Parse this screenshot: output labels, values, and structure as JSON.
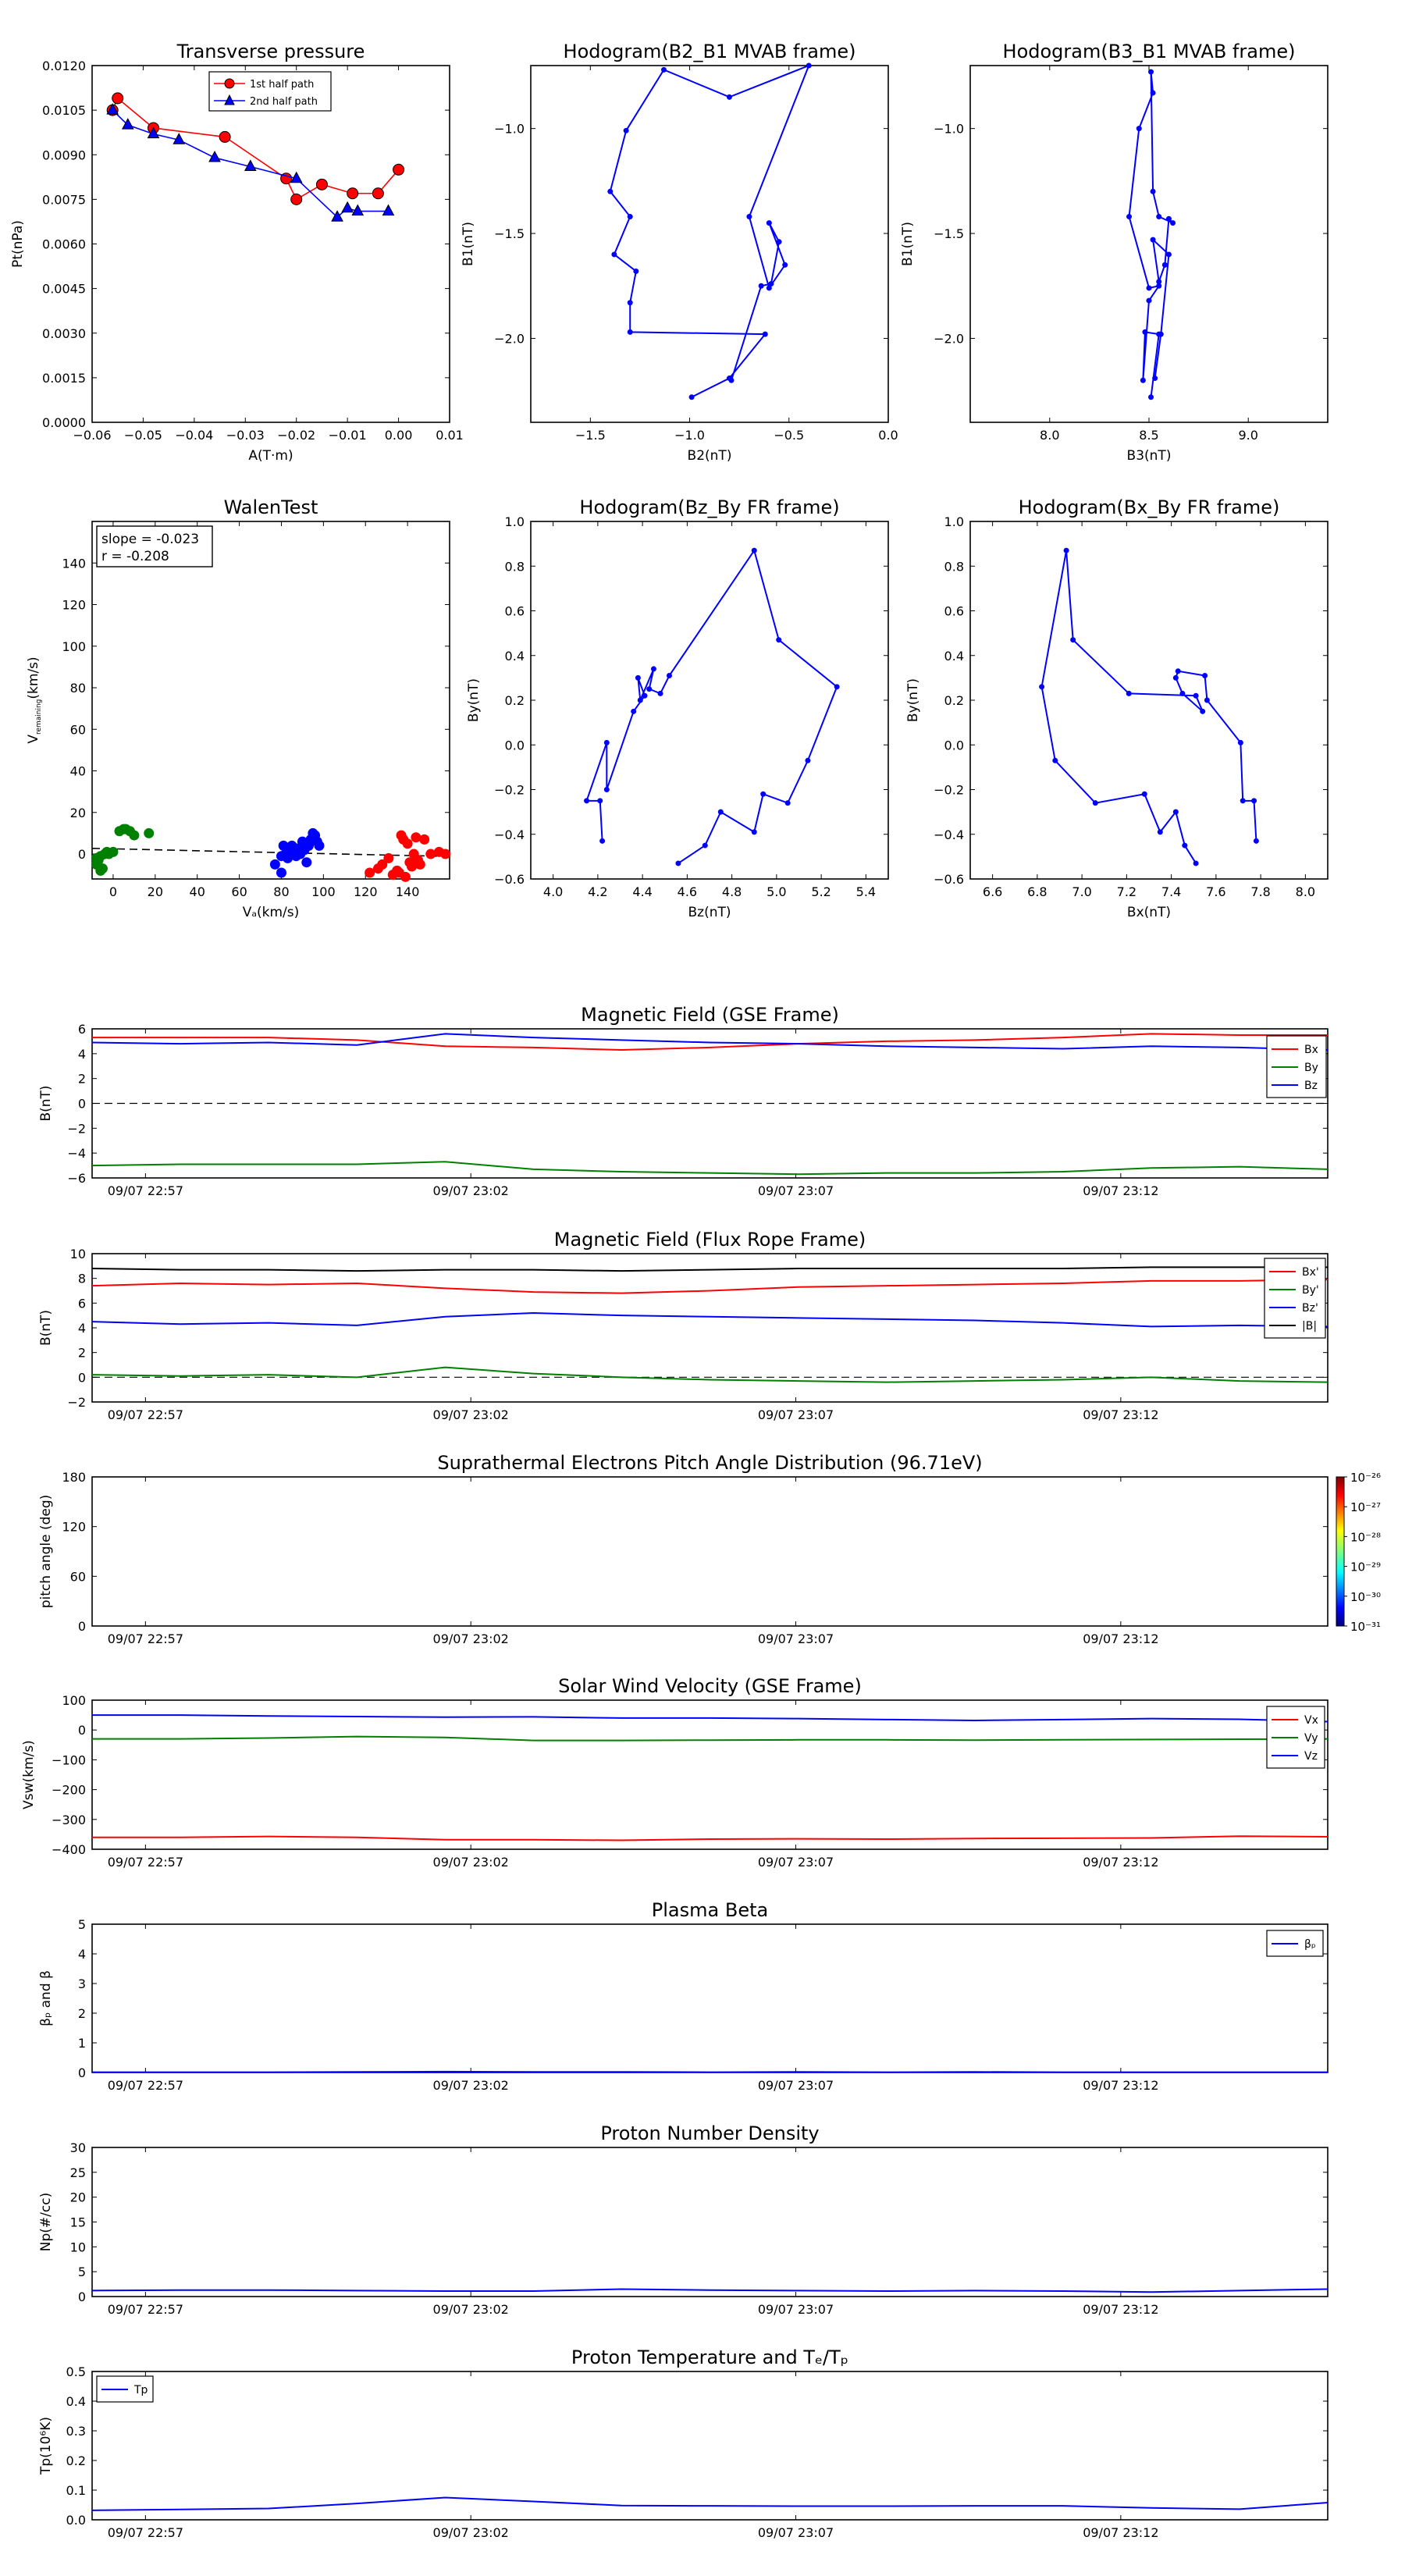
{
  "chart_data": [
    {
      "id": "pt",
      "type": "scatter",
      "title": "Transverse pressure",
      "xlabel": "A(T·m)",
      "ylabel": "Pt(nPa)",
      "xlim": [
        -0.06,
        0.01
      ],
      "ylim": [
        0.0,
        0.012
      ],
      "xticks": [
        -0.06,
        -0.05,
        -0.04,
        -0.03,
        -0.02,
        -0.01,
        0.0,
        0.01
      ],
      "xtick_labels": [
        "−0.06",
        "−0.05",
        "−0.04",
        "−0.03",
        "−0.02",
        "−0.01",
        "0.00",
        "0.01"
      ],
      "yticks": [
        0.0,
        0.0015,
        0.003,
        0.0045,
        0.006,
        0.0075,
        0.009,
        0.0105,
        0.012
      ],
      "ytick_labels": [
        "0.0000",
        "0.0015",
        "0.0030",
        "0.0045",
        "0.0060",
        "0.0075",
        "0.0090",
        "0.0105",
        "0.0120"
      ],
      "legend": "top-center",
      "series": [
        {
          "name": "1st half path",
          "color": "#ff0000",
          "marker": "circle",
          "x": [
            -0.056,
            -0.055,
            -0.048,
            -0.034,
            -0.022,
            -0.02,
            -0.015,
            -0.009,
            -0.004,
            0.0
          ],
          "y": [
            0.0105,
            0.0109,
            0.0099,
            0.0096,
            0.0082,
            0.0075,
            0.008,
            0.0077,
            0.0077,
            0.0085
          ]
        },
        {
          "name": "2nd half path",
          "color": "#0000ff",
          "marker": "triangle",
          "x": [
            -0.056,
            -0.053,
            -0.048,
            -0.043,
            -0.036,
            -0.029,
            -0.02,
            -0.012,
            -0.01,
            -0.008,
            -0.002
          ],
          "y": [
            0.0105,
            0.01,
            0.0097,
            0.0095,
            0.0089,
            0.0086,
            0.0082,
            0.0069,
            0.0072,
            0.0071,
            0.0071
          ]
        }
      ]
    },
    {
      "id": "hodo1",
      "type": "line",
      "title": "Hodogram(B2_B1 MVAB frame)",
      "xlabel": "B2(nT)",
      "ylabel": "B1(nT)",
      "xlim": [
        -1.8,
        0.0
      ],
      "ylim": [
        -2.4,
        -0.7
      ],
      "xticks": [
        -1.5,
        -1.0,
        -0.5,
        0.0
      ],
      "xtick_labels": [
        "−1.5",
        "−1.0",
        "−0.5",
        "0.0"
      ],
      "yticks": [
        -2.0,
        -1.5,
        -1.0
      ],
      "ytick_labels": [
        "−2.0",
        "−1.5",
        "−1.0"
      ],
      "color": "#0000ff",
      "x": [
        -0.99,
        -0.8,
        -0.62,
        -1.3,
        -1.3,
        -1.27,
        -1.38,
        -1.3,
        -1.4,
        -1.32,
        -1.13,
        -0.8,
        -0.4,
        -0.7,
        -0.6,
        -0.52,
        -0.6,
        -0.55,
        -0.59,
        -0.64,
        -0.79
      ],
      "y": [
        -2.28,
        -2.19,
        -1.98,
        -1.97,
        -1.83,
        -1.68,
        -1.6,
        -1.42,
        -1.3,
        -1.01,
        -0.72,
        -0.85,
        -0.7,
        -1.42,
        -1.76,
        -1.65,
        -1.45,
        -1.54,
        -1.74,
        -1.75,
        -2.2
      ]
    },
    {
      "id": "hodo2",
      "type": "line",
      "title": "Hodogram(B3_B1 MVAB frame)",
      "xlabel": "B3(nT)",
      "ylabel": "B1(nT)",
      "xlim": [
        7.6,
        9.4
      ],
      "ylim": [
        -2.4,
        -0.7
      ],
      "xticks": [
        8.0,
        8.5,
        9.0
      ],
      "xtick_labels": [
        "8.0",
        "8.5",
        "9.0"
      ],
      "yticks": [
        -2.0,
        -1.5,
        -1.0
      ],
      "ytick_labels": [
        "−2.0",
        "−1.5",
        "−1.0"
      ],
      "color": "#0000ff",
      "x": [
        8.51,
        8.55,
        8.48,
        8.47,
        8.5,
        8.55,
        8.5,
        8.4,
        8.45,
        8.52,
        8.51,
        8.52,
        8.55,
        8.62,
        8.6,
        8.58,
        8.55,
        8.52,
        8.6,
        8.56,
        8.53
      ],
      "y": [
        -2.28,
        -1.98,
        -1.97,
        -2.2,
        -1.82,
        -1.75,
        -1.76,
        -1.42,
        -1.0,
        -0.83,
        -0.73,
        -1.3,
        -1.42,
        -1.45,
        -1.43,
        -1.65,
        -1.73,
        -1.53,
        -1.6,
        -1.98,
        -2.19
      ]
    },
    {
      "id": "walen",
      "type": "scatter",
      "title": "WalenTest",
      "xlabel": "Vₐ(km/s)",
      "ylabel_main": "V",
      "ylabel_sub": "remaining",
      "ylabel_suffix": "(km/s)",
      "xlim": [
        -10,
        160
      ],
      "ylim": [
        -12,
        160
      ],
      "xticks": [
        0,
        20,
        40,
        60,
        80,
        100,
        120,
        140
      ],
      "xtick_labels": [
        "0",
        "20",
        "40",
        "60",
        "80",
        "100",
        "120",
        "140"
      ],
      "yticks": [
        0,
        20,
        40,
        60,
        80,
        100,
        120,
        140
      ],
      "ytick_labels": [
        "0",
        "20",
        "40",
        "60",
        "80",
        "100",
        "120",
        "140"
      ],
      "annotation_lines": [
        "slope = -0.023",
        "r = -0.208"
      ],
      "fit": {
        "slope": -0.023,
        "intercept": 2.5
      },
      "series": [
        {
          "color": "#008000",
          "x": [
            -8,
            -7,
            -6,
            -5,
            -4,
            -3,
            -2,
            0,
            3,
            5,
            6,
            8,
            10,
            17,
            -8,
            -6
          ],
          "y": [
            -5,
            -3,
            -1,
            -7,
            0,
            1,
            0,
            1,
            11,
            12,
            12,
            11,
            9,
            10,
            -2,
            -8
          ]
        },
        {
          "color": "#0000ff",
          "x": [
            77,
            80,
            81,
            82,
            83,
            84,
            85,
            86,
            87,
            88,
            89,
            90,
            91,
            92,
            93,
            94,
            95,
            96,
            97,
            98,
            80,
            84,
            89
          ],
          "y": [
            -5,
            -9,
            4,
            0,
            -2,
            1,
            4,
            3,
            -1,
            0,
            0,
            6,
            2,
            -4,
            4,
            7,
            10,
            9,
            6,
            4,
            -1,
            0,
            3
          ]
        },
        {
          "color": "#ff0000",
          "x": [
            122,
            126,
            128,
            131,
            133,
            135,
            137,
            138,
            140,
            141,
            142,
            143,
            144,
            145,
            146,
            148,
            151,
            155,
            158,
            139,
            136
          ],
          "y": [
            -9,
            -7,
            -5,
            -2,
            -10,
            -8,
            9,
            7,
            5,
            -4,
            -6,
            0,
            8,
            -3,
            -5,
            7,
            0,
            1,
            0,
            -11,
            -9
          ]
        }
      ]
    },
    {
      "id": "hodo3",
      "type": "line",
      "title": "Hodogram(Bz_By FR frame)",
      "xlabel": "Bz(nT)",
      "ylabel": "By(nT)",
      "xlim": [
        3.9,
        5.5
      ],
      "ylim": [
        -0.6,
        1.0
      ],
      "xticks": [
        4.0,
        4.2,
        4.4,
        4.6,
        4.8,
        5.0,
        5.2,
        5.4
      ],
      "xtick_labels": [
        "4.0",
        "4.2",
        "4.4",
        "4.6",
        "4.8",
        "5.0",
        "5.2",
        "5.4"
      ],
      "yticks": [
        -0.6,
        -0.4,
        -0.2,
        0.0,
        0.2,
        0.4,
        0.6,
        0.8,
        1.0
      ],
      "ytick_labels": [
        "−0.6",
        "−0.4",
        "−0.2",
        "0.0",
        "0.2",
        "0.4",
        "0.6",
        "0.8",
        "1.0"
      ],
      "color": "#0000ff",
      "x": [
        4.22,
        4.21,
        4.15,
        4.24,
        4.24,
        4.36,
        4.41,
        4.38,
        4.39,
        4.45,
        4.43,
        4.48,
        4.52,
        4.9,
        5.01,
        5.27,
        5.14,
        5.05,
        4.94,
        4.9,
        4.75,
        4.68,
        4.56
      ],
      "y": [
        -0.43,
        -0.25,
        -0.25,
        0.01,
        -0.2,
        0.15,
        0.22,
        0.3,
        0.2,
        0.34,
        0.25,
        0.23,
        0.31,
        0.87,
        0.47,
        0.26,
        -0.07,
        -0.26,
        -0.22,
        -0.39,
        -0.3,
        -0.45,
        -0.53
      ]
    },
    {
      "id": "hodo4",
      "type": "line",
      "title": "Hodogram(Bx_By FR frame)",
      "xlabel": "Bx(nT)",
      "ylabel": "By(nT)",
      "xlim": [
        6.5,
        8.1
      ],
      "ylim": [
        -0.6,
        1.0
      ],
      "xticks": [
        6.6,
        6.8,
        7.0,
        7.2,
        7.4,
        7.6,
        7.8,
        8.0
      ],
      "xtick_labels": [
        "6.6",
        "6.8",
        "7.0",
        "7.2",
        "7.4",
        "7.6",
        "7.8",
        "8.0"
      ],
      "yticks": [
        -0.6,
        -0.4,
        -0.2,
        0.0,
        0.2,
        0.4,
        0.6,
        0.8,
        1.0
      ],
      "ytick_labels": [
        "−0.6",
        "−0.4",
        "−0.2",
        "0.0",
        "0.2",
        "0.4",
        "0.6",
        "0.8",
        "1.0"
      ],
      "color": "#0000ff",
      "x": [
        7.78,
        7.77,
        7.72,
        7.71,
        7.56,
        7.55,
        7.43,
        7.42,
        7.45,
        7.54,
        7.51,
        7.21,
        6.96,
        6.93,
        6.82,
        6.88,
        7.06,
        7.28,
        7.35,
        7.42,
        7.46,
        7.51
      ],
      "y": [
        -0.43,
        -0.25,
        -0.25,
        0.01,
        0.2,
        0.31,
        0.33,
        0.3,
        0.23,
        0.15,
        0.22,
        0.23,
        0.47,
        0.87,
        0.26,
        -0.07,
        -0.26,
        -0.22,
        -0.39,
        -0.3,
        -0.45,
        -0.53
      ]
    },
    {
      "id": "bgse",
      "type": "line",
      "title": "Magnetic Field (GSE Frame)",
      "ylabel": "B(nT)",
      "ylim": [
        -6,
        6
      ],
      "yticks": [
        -6,
        -4,
        -2,
        0,
        2,
        4,
        6
      ],
      "ytick_labels": [
        "−6",
        "−4",
        "−2",
        "0",
        "2",
        "4",
        "6"
      ],
      "xticks": [
        "09/07 22:57",
        "09/07 23:02",
        "09/07 23:07",
        "09/07 23:12"
      ],
      "legend": "right",
      "zero_line": true,
      "series": [
        {
          "name": "Bx",
          "color": "#ff0000",
          "values": [
            5.3,
            5.3,
            5.3,
            5.1,
            4.6,
            4.5,
            4.3,
            4.5,
            4.8,
            5.0,
            5.1,
            5.3,
            5.6,
            5.5,
            5.5
          ]
        },
        {
          "name": "By",
          "color": "#008000",
          "values": [
            -5.0,
            -4.9,
            -4.9,
            -4.9,
            -4.7,
            -5.3,
            -5.5,
            -5.6,
            -5.7,
            -5.6,
            -5.6,
            -5.5,
            -5.2,
            -5.1,
            -5.3
          ]
        },
        {
          "name": "Bz",
          "color": "#0000ff",
          "values": [
            4.9,
            4.8,
            4.9,
            4.7,
            5.6,
            5.3,
            5.1,
            4.9,
            4.8,
            4.6,
            4.5,
            4.4,
            4.6,
            4.5,
            4.3
          ]
        }
      ]
    },
    {
      "id": "bfr",
      "type": "line",
      "title": "Magnetic Field (Flux Rope Frame)",
      "ylabel": "B(nT)",
      "ylim": [
        -2,
        10
      ],
      "yticks": [
        -2,
        0,
        2,
        4,
        6,
        8,
        10
      ],
      "ytick_labels": [
        "−2",
        "0",
        "2",
        "4",
        "6",
        "8",
        "10"
      ],
      "xticks": [
        "09/07 22:57",
        "09/07 23:02",
        "09/07 23:07",
        "09/07 23:12"
      ],
      "legend": "right",
      "zero_line": true,
      "series": [
        {
          "name": "Bx'",
          "color": "#ff0000",
          "values": [
            7.4,
            7.6,
            7.5,
            7.6,
            7.2,
            6.9,
            6.8,
            7.0,
            7.3,
            7.4,
            7.5,
            7.6,
            7.8,
            7.8,
            7.9
          ]
        },
        {
          "name": "By'",
          "color": "#008000",
          "values": [
            0.2,
            0.1,
            0.2,
            0.0,
            0.8,
            0.3,
            0.0,
            -0.2,
            -0.3,
            -0.4,
            -0.3,
            -0.2,
            0.0,
            -0.3,
            -0.4
          ]
        },
        {
          "name": "Bz'",
          "color": "#0000ff",
          "values": [
            4.5,
            4.3,
            4.4,
            4.2,
            4.9,
            5.2,
            5.0,
            4.9,
            4.8,
            4.7,
            4.6,
            4.4,
            4.1,
            4.2,
            4.1
          ]
        },
        {
          "name": "|B|",
          "color": "#000000",
          "values": [
            8.8,
            8.7,
            8.7,
            8.6,
            8.7,
            8.7,
            8.6,
            8.7,
            8.8,
            8.8,
            8.8,
            8.8,
            8.9,
            8.9,
            8.9
          ]
        }
      ]
    },
    {
      "id": "pad",
      "type": "heatmap",
      "title": "Suprathermal Electrons Pitch Angle Distribution (96.71eV)",
      "ylabel": "pitch angle (deg)",
      "ylim": [
        0,
        180
      ],
      "yticks": [
        0,
        60,
        120,
        180
      ],
      "ytick_labels": [
        "0",
        "60",
        "120",
        "180"
      ],
      "xticks": [
        "09/07 22:57",
        "09/07 23:02",
        "09/07 23:07",
        "09/07 23:12"
      ],
      "colorbar_labels": [
        "10⁻²⁶",
        "10⁻²⁷",
        "10⁻²⁸",
        "10⁻²⁹",
        "10⁻³⁰",
        "10⁻³¹"
      ]
    },
    {
      "id": "vsw",
      "type": "line",
      "title": "Solar Wind Velocity (GSE Frame)",
      "ylabel": "Vsw(km/s)",
      "ylim": [
        -400,
        100
      ],
      "yticks": [
        -400,
        -300,
        -200,
        -100,
        0,
        100
      ],
      "ytick_labels": [
        "−400",
        "−300",
        "−200",
        "−100",
        "0",
        "100"
      ],
      "xticks": [
        "09/07 22:57",
        "09/07 23:02",
        "09/07 23:07",
        "09/07 23:12"
      ],
      "legend": "right",
      "series": [
        {
          "name": "Vx",
          "color": "#ff0000",
          "values": [
            -360,
            -360,
            -357,
            -360,
            -368,
            -368,
            -370,
            -366,
            -365,
            -366,
            -364,
            -363,
            -362,
            -356,
            -358
          ]
        },
        {
          "name": "Vy",
          "color": "#008000",
          "values": [
            -30,
            -30,
            -27,
            -22,
            -25,
            -35,
            -35,
            -34,
            -33,
            -33,
            -34,
            -33,
            -32,
            -31,
            -30
          ]
        },
        {
          "name": "Vz",
          "color": "#0000ff",
          "values": [
            50,
            50,
            47,
            45,
            43,
            44,
            40,
            40,
            38,
            35,
            32,
            35,
            38,
            36,
            28
          ]
        }
      ]
    },
    {
      "id": "beta",
      "type": "line",
      "title": "Plasma Beta",
      "ylabel": "βₚ and β",
      "ylim": [
        0,
        5
      ],
      "yticks": [
        0,
        1,
        2,
        3,
        4,
        5
      ],
      "ytick_labels": [
        "0",
        "1",
        "2",
        "3",
        "4",
        "5"
      ],
      "xticks": [
        "09/07 22:57",
        "09/07 23:02",
        "09/07 23:07",
        "09/07 23:12"
      ],
      "legend": "top-right",
      "series": [
        {
          "name": "βₚ",
          "color": "#0000ff",
          "values": [
            0.01,
            0.01,
            0.01,
            0.02,
            0.03,
            0.02,
            0.02,
            0.01,
            0.02,
            0.01,
            0.02,
            0.01,
            0.01,
            0.01,
            0.01
          ]
        }
      ]
    },
    {
      "id": "np",
      "type": "line",
      "title": "Proton Number Density",
      "ylabel": "Np(#/cc)",
      "ylim": [
        0,
        30
      ],
      "yticks": [
        0,
        5,
        10,
        15,
        20,
        25,
        30
      ],
      "ytick_labels": [
        "0",
        "5",
        "10",
        "15",
        "20",
        "25",
        "30"
      ],
      "xticks": [
        "09/07 22:57",
        "09/07 23:02",
        "09/07 23:07",
        "09/07 23:12"
      ],
      "series": [
        {
          "name": "Np",
          "color": "#0000ff",
          "values": [
            1.2,
            1.3,
            1.3,
            1.2,
            1.1,
            1.1,
            1.5,
            1.3,
            1.2,
            1.1,
            1.2,
            1.1,
            0.9,
            1.2,
            1.5
          ]
        }
      ]
    },
    {
      "id": "tp",
      "type": "line",
      "title": "Proton Temperature and Tₑ/Tₚ",
      "ylabel": "Tp(10⁶K)",
      "ylim": [
        0.0,
        0.5
      ],
      "yticks": [
        0.0,
        0.1,
        0.2,
        0.3,
        0.4,
        0.5
      ],
      "ytick_labels": [
        "0.0",
        "0.1",
        "0.2",
        "0.3",
        "0.4",
        "0.5"
      ],
      "xticks": [
        "09/07 22:57",
        "09/07 23:02",
        "09/07 23:07",
        "09/07 23:12"
      ],
      "legend": "top-left",
      "series": [
        {
          "name": "Tp",
          "color": "#0000ff",
          "values": [
            0.032,
            0.035,
            0.038,
            0.055,
            0.075,
            0.062,
            0.048,
            0.047,
            0.046,
            0.046,
            0.047,
            0.047,
            0.04,
            0.036,
            0.058
          ]
        }
      ]
    }
  ]
}
